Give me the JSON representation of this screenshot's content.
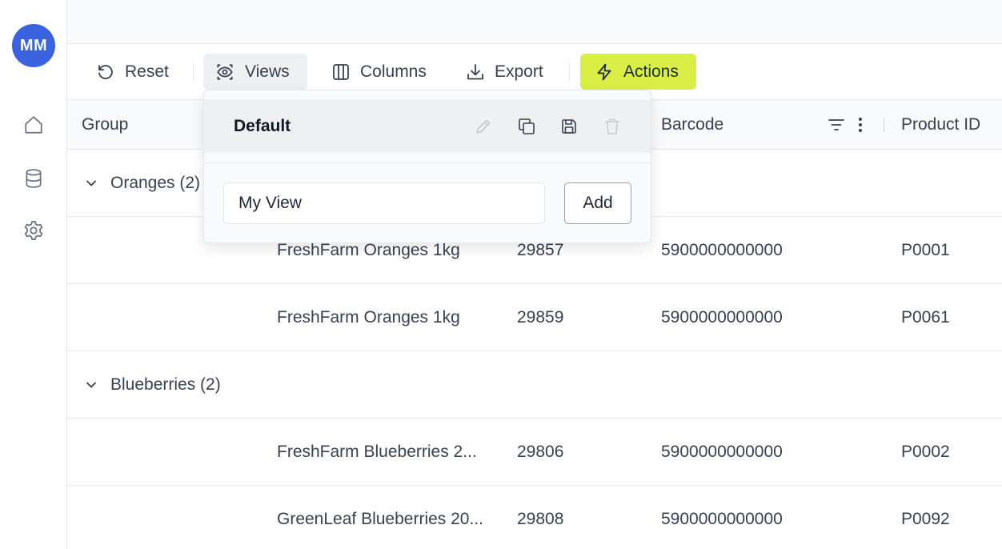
{
  "user": {
    "initials": "MM"
  },
  "sidebar": {
    "items": [
      {
        "icon": "home-icon"
      },
      {
        "icon": "database-icon"
      },
      {
        "icon": "gear-icon"
      }
    ]
  },
  "toolbar": {
    "reset_label": "Reset",
    "views_label": "Views",
    "columns_label": "Columns",
    "export_label": "Export",
    "actions_label": "Actions",
    "actions_color": "#d9ef45"
  },
  "table": {
    "headers": {
      "group": "Group",
      "barcode": "Barcode",
      "product_id": "Product ID"
    },
    "groups": [
      {
        "label": "Oranges (2)",
        "rows": [
          {
            "name": "FreshFarm Oranges 1kg",
            "code": "29857",
            "barcode": "5900000000000",
            "product_id": "P0001"
          },
          {
            "name": "FreshFarm Oranges 1kg",
            "code": "29859",
            "barcode": "5900000000000",
            "product_id": "P0061"
          }
        ]
      },
      {
        "label": "Blueberries (2)",
        "rows": [
          {
            "name": "FreshFarm Blueberries 2...",
            "code": "29806",
            "barcode": "5900000000000",
            "product_id": "P0002"
          },
          {
            "name": "GreenLeaf Blueberries 20...",
            "code": "29808",
            "barcode": "5900000000000",
            "product_id": "P0092"
          }
        ]
      }
    ]
  },
  "views_popover": {
    "current_view": "Default",
    "new_view_value": "My View",
    "add_label": "Add"
  }
}
